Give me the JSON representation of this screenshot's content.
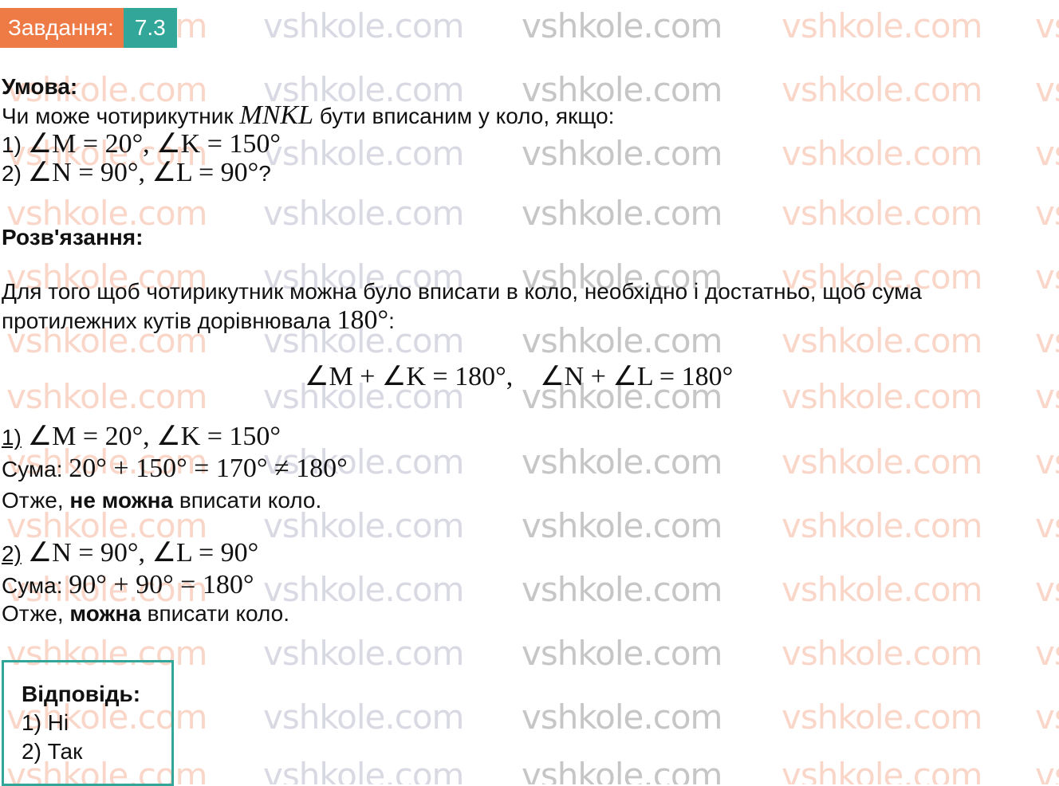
{
  "header": {
    "label": "Завдання:",
    "number": "7.3"
  },
  "watermark": "vshkole.com",
  "condition": {
    "heading": "Умова:",
    "question_prefix": "Чи може чотирикутник",
    "question_var": "MNKL",
    "question_suffix": "бути вписаним у коло, якщо:",
    "item1_num": "1)",
    "item1_math": "∠M = 20°, ∠K = 150°",
    "item2_num": "2)",
    "item2_math": "∠N = 90°, ∠L = 90°",
    "item2_end": "?"
  },
  "solution": {
    "heading": "Розв'язання:",
    "intro_line1": "Для того щоб чотирикутник можна було вписати в коло, необхідно і достатньо, щоб сума",
    "intro_line2_text": "протилежних кутів дорівнювала",
    "intro_line2_math": "180°",
    "intro_line2_end": ":",
    "formula": "∠M + ∠K = 180°,    ∠N + ∠L = 180°",
    "case1": {
      "num": "1)",
      "math": "∠M = 20°, ∠K = 150°",
      "sum_label": "Сума:",
      "sum_math": "20° + 150° = 170° ≠ 180°",
      "concl_prefix": "Отже,",
      "concl_bold": "не можна",
      "concl_suffix": "вписати коло."
    },
    "case2": {
      "num": "2)",
      "math": "∠N = 90°, ∠L = 90°",
      "sum_label": "Сума:",
      "sum_math": "90° + 90° = 180°",
      "concl_prefix": "Отже,",
      "concl_bold": "можна",
      "concl_suffix": "вписати коло."
    }
  },
  "answer": {
    "heading": "Відповідь:",
    "line1": "1) Ні",
    "line2": "2) Так"
  },
  "colors": {
    "header_orange": "#ee7a45",
    "header_teal": "#33a69a",
    "answer_border": "#33a69a"
  }
}
